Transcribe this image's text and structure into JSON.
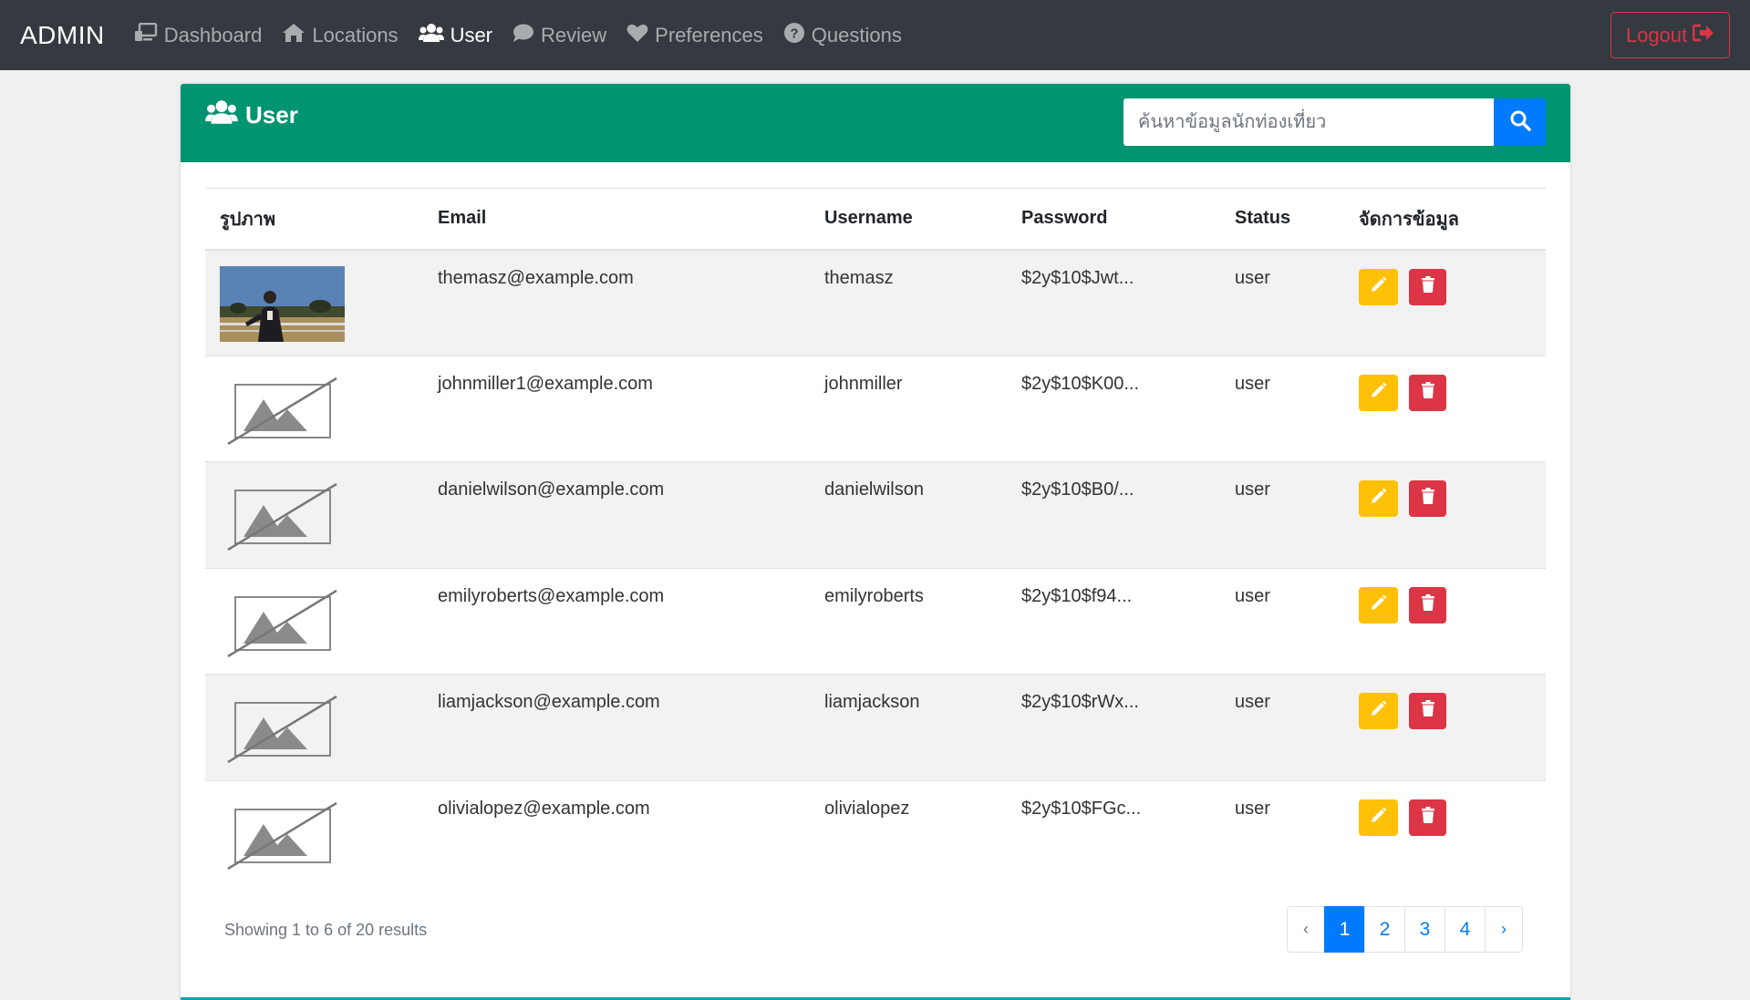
{
  "navbar": {
    "brand": "ADMIN",
    "items": [
      {
        "label": "Dashboard",
        "icon": "dashboard-icon",
        "active": false
      },
      {
        "label": "Locations",
        "icon": "home-icon",
        "active": false
      },
      {
        "label": "User",
        "icon": "users-icon",
        "active": true
      },
      {
        "label": "Review",
        "icon": "comment-icon",
        "active": false
      },
      {
        "label": "Preferences",
        "icon": "heart-icon",
        "active": false
      },
      {
        "label": "Questions",
        "icon": "question-circle-icon",
        "active": false
      }
    ],
    "logout_label": "Logout"
  },
  "card": {
    "title": "User",
    "search_placeholder": "ค้นหาข้อมูลนักท่องเที่ยว"
  },
  "table": {
    "headers": {
      "image": "รูปภาพ",
      "email": "Email",
      "username": "Username",
      "password": "Password",
      "status": "Status",
      "actions": "จัดการข้อมูล"
    },
    "rows": [
      {
        "has_photo": true,
        "email": "themasz@example.com",
        "username": "themasz",
        "password": "$2y$10$Jwt...",
        "status": "user"
      },
      {
        "has_photo": false,
        "email": "johnmiller1@example.com",
        "username": "johnmiller",
        "password": "$2y$10$K00...",
        "status": "user"
      },
      {
        "has_photo": false,
        "email": "danielwilson@example.com",
        "username": "danielwilson",
        "password": "$2y$10$B0/...",
        "status": "user"
      },
      {
        "has_photo": false,
        "email": "emilyroberts@example.com",
        "username": "emilyroberts",
        "password": "$2y$10$f94...",
        "status": "user"
      },
      {
        "has_photo": false,
        "email": "liamjackson@example.com",
        "username": "liamjackson",
        "password": "$2y$10$rWx...",
        "status": "user"
      },
      {
        "has_photo": false,
        "email": "olivialopez@example.com",
        "username": "olivialopez",
        "password": "$2y$10$FGc...",
        "status": "user"
      }
    ]
  },
  "footer": {
    "showing": "Showing 1 to 6 of 20 results"
  },
  "pagination": {
    "prev": "‹",
    "pages": [
      "1",
      "2",
      "3",
      "4"
    ],
    "active_page": "1",
    "next": "›"
  },
  "colors": {
    "navbar_bg": "#343a40",
    "header_green": "#009471",
    "primary_blue": "#007bff",
    "edit_yellow": "#ffc107",
    "delete_red": "#dc3545"
  }
}
